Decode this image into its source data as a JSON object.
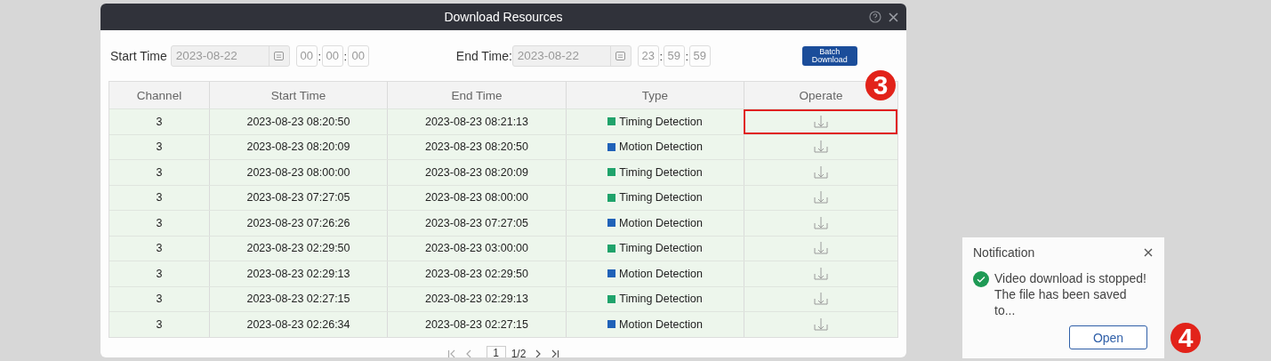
{
  "dialog": {
    "title": "Download Resources",
    "filters": {
      "start_label": "Start Time",
      "start_date": "2023-08-22",
      "start_time": [
        "00",
        "00",
        "00"
      ],
      "separator": ":",
      "end_label": "End Time:",
      "end_date": "2023-08-22",
      "end_time": [
        "23",
        "59",
        "59"
      ],
      "batch_button": "Batch Download"
    },
    "table": {
      "columns": [
        "Channel",
        "Start Time",
        "End Time",
        "Type",
        "Operate"
      ],
      "rows": [
        {
          "channel": "3",
          "start": "2023-08-23 08:20:50",
          "end": "2023-08-23 08:21:13",
          "type": "Timing Detection",
          "color": "#1fa36b",
          "highlighted": true
        },
        {
          "channel": "3",
          "start": "2023-08-23 08:20:09",
          "end": "2023-08-23 08:20:50",
          "type": "Motion Detection",
          "color": "#2062b8",
          "highlighted": false
        },
        {
          "channel": "3",
          "start": "2023-08-23 08:00:00",
          "end": "2023-08-23 08:20:09",
          "type": "Timing Detection",
          "color": "#1fa36b",
          "highlighted": false
        },
        {
          "channel": "3",
          "start": "2023-08-23 07:27:05",
          "end": "2023-08-23 08:00:00",
          "type": "Timing Detection",
          "color": "#1fa36b",
          "highlighted": false
        },
        {
          "channel": "3",
          "start": "2023-08-23 07:26:26",
          "end": "2023-08-23 07:27:05",
          "type": "Motion Detection",
          "color": "#2062b8",
          "highlighted": false
        },
        {
          "channel": "3",
          "start": "2023-08-23 02:29:50",
          "end": "2023-08-23 03:00:00",
          "type": "Timing Detection",
          "color": "#1fa36b",
          "highlighted": false
        },
        {
          "channel": "3",
          "start": "2023-08-23 02:29:13",
          "end": "2023-08-23 02:29:50",
          "type": "Motion Detection",
          "color": "#2062b8",
          "highlighted": false
        },
        {
          "channel": "3",
          "start": "2023-08-23 02:27:15",
          "end": "2023-08-23 02:29:13",
          "type": "Timing Detection",
          "color": "#1fa36b",
          "highlighted": false
        },
        {
          "channel": "3",
          "start": "2023-08-23 02:26:34",
          "end": "2023-08-23 02:27:15",
          "type": "Motion Detection",
          "color": "#2062b8",
          "highlighted": false
        }
      ]
    },
    "pager": {
      "page": "1",
      "total": "1/2"
    }
  },
  "notification": {
    "title": "Notification",
    "message": "Video download is stopped! The file has been saved to...",
    "button": "Open"
  },
  "callouts": [
    "3",
    "4"
  ]
}
